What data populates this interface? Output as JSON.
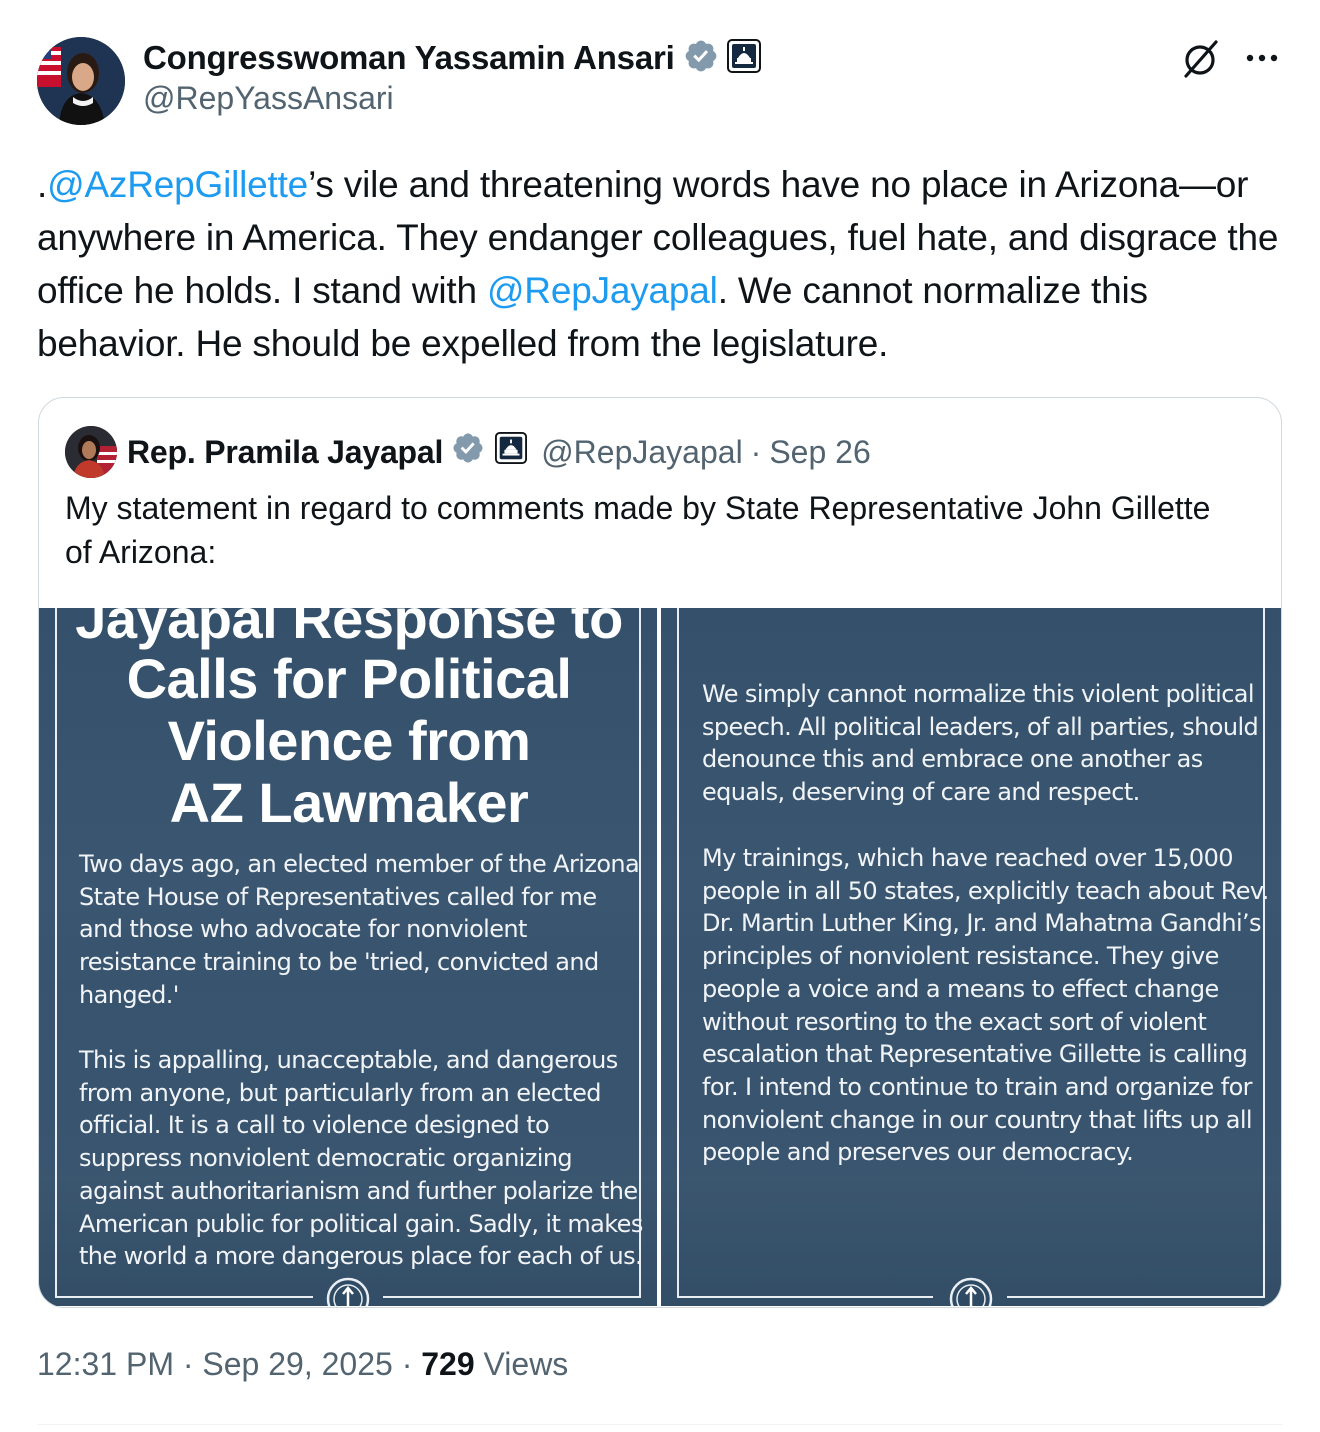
{
  "author": {
    "display_name": "Congresswoman Yassamin Ansari",
    "handle": "@RepYassAnsari"
  },
  "tweet": {
    "text_parts": [
      {
        "text": ".",
        "type": "plain"
      },
      {
        "text": "@AzRepGillette",
        "type": "mention"
      },
      {
        "text": "’s vile and threatening words have no place in Arizona—or anywhere in America. They endanger colleagues, fuel hate, and disgrace the office he holds. I stand with ",
        "type": "plain"
      },
      {
        "text": "@RepJayapal",
        "type": "mention"
      },
      {
        "text": ". We cannot normalize this behavior. He should be expelled from the legislature.",
        "type": "plain"
      }
    ]
  },
  "quote": {
    "display_name": "Rep. Pramila Jayapal",
    "handle": "@RepJayapal",
    "separator": "·",
    "date": "Sep 26",
    "text": "My statement in regard to comments made by State Representative John Gillette of Arizona:",
    "image_left": {
      "headline_clipped": "Jayapal Response to",
      "headline_lines": [
        "Calls for Political",
        "Violence from",
        "AZ Lawmaker"
      ],
      "paragraph1_lines": [
        "Two days ago, an elected member of the Arizona",
        "State House of Representatives called for me",
        "and those who advocate for nonviolent",
        "resistance training to be 'tried, convicted and",
        "hanged.'"
      ],
      "paragraph2_lines": [
        "This is appalling, unacceptable, and dangerous",
        "from anyone, but particularly from an elected",
        "official. It is a call to violence designed to",
        "suppress nonviolent democratic organizing",
        "against authoritarianism and further polarize the",
        "American public for political gain. Sadly, it makes",
        "the world a more dangerous place for each of us."
      ]
    },
    "image_right": {
      "paragraph1_lines": [
        "We simply cannot normalize this violent political",
        "speech. All political leaders, of all parties, should",
        "denounce this and embrace one another as",
        "equals, deserving of care and respect."
      ],
      "paragraph2_lines": [
        "My trainings, which have reached over 15,000",
        "people in all 50 states, explicitly teach about Rev.",
        "Dr. Martin Luther King, Jr. and Mahatma Gandhi’s",
        "principles of nonviolent resistance. They give",
        "people a voice and a means to effect change",
        "without resorting to the exact sort of violent",
        "escalation that Representative Gillette is calling",
        "for. I intend to continue to train and organize for",
        "nonviolent change in our country that lifts up all",
        "people and preserves our democracy."
      ]
    }
  },
  "meta": {
    "time": "12:31 PM",
    "separator": "·",
    "date": "Sep 29, 2025",
    "views_count": "729",
    "views_label": "Views"
  },
  "icons": {
    "verified": "verified-badge-icon",
    "government": "government-capitol-icon",
    "grok": "grok-icon",
    "more": "more-icon"
  },
  "colors": {
    "text": "#0f1419",
    "secondary": "#536471",
    "mention": "#1d9bf0",
    "verified_badge": "#829aab",
    "image_bg": "#34506a"
  }
}
